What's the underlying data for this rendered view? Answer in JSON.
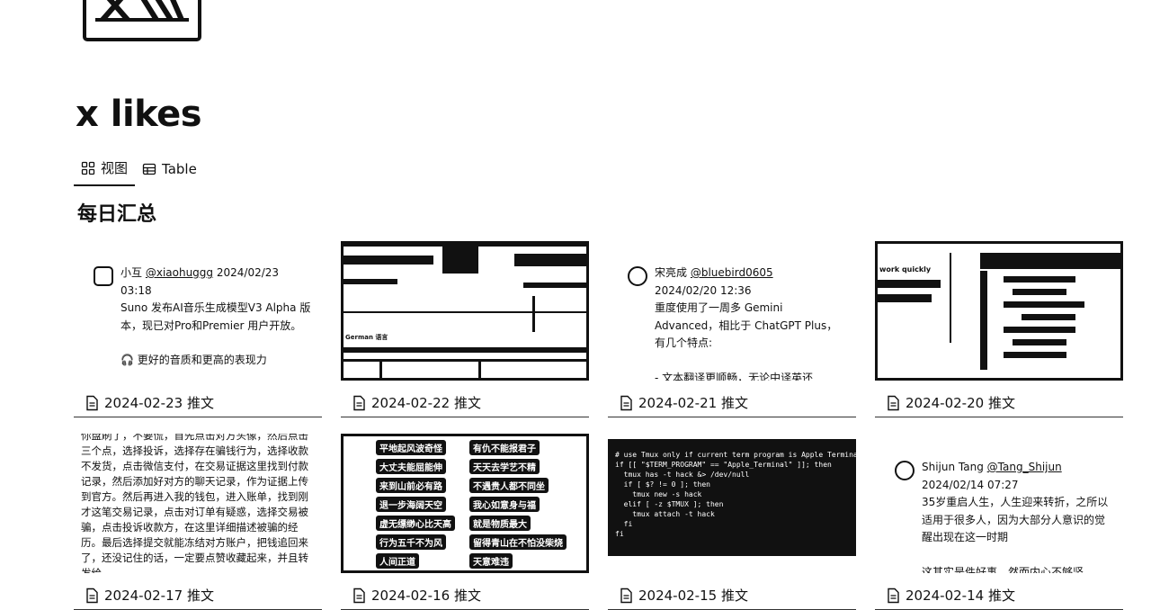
{
  "page": {
    "title": "x likes"
  },
  "tabs": [
    {
      "label": "视图",
      "icon": "gallery-icon",
      "active": true
    },
    {
      "label": "Table",
      "icon": "table-icon",
      "active": false
    }
  ],
  "section": {
    "title": "每日汇总"
  },
  "cards": [
    {
      "footer": "2024-02-23 推文",
      "tweet": {
        "author": "小互",
        "handle": "@xiaohuggg",
        "date": "2024/02/23 03:18",
        "text": "Suno 发布AI音乐生成模型V3 Alpha 版本，现已对Pro和Premier 用户开放。",
        "extra": "🎧 更好的音质和更高的表现力"
      }
    },
    {
      "footer": "2024-02-22 推文",
      "image": "video-screenshot",
      "caption": "German 语言"
    },
    {
      "footer": "2024-02-21 推文",
      "tweet": {
        "author": "宋亮成",
        "handle": "@bluebird0605",
        "date": "2024/02/20 12:36",
        "text": "重度使用了一周多 Gemini Advanced，相比于 ChatGPT Plus，有几个特点:",
        "extra": "- 文本翻译更顺畅，无论中译英还"
      }
    },
    {
      "footer": "2024-02-20 推文",
      "image": "app-screenshot",
      "caption": "work quickly"
    },
    {
      "footer": "2024-02-17 推文",
      "text_block": "你盘刷了，不要慌，首先点击对方头像，然后点击三个点，选择投诉，选择存在骗钱行为，选择收款不发货，点击微信支付，在交易证据这里找到付款记录，然后添加好对方的聊天记录，作为证据上传到官方。然后再进入我的钱包，进入账单，找到刚才这笔交易记录，点击对订单有疑惑，选择交易被骗，点击投诉收款方，在这里详细描述被骗的经历。最后选择提交就能冻结对方账户，把钱追回来了，还没记住的话，一定要点赞收藏起来，并且转发给"
    },
    {
      "footer": "2024-02-16 推文",
      "signs": [
        "平地起风波奇怪",
        "有仇不能报君子",
        "大丈夫能屈能伸",
        "天天去学艺不精",
        "来到山前必有路",
        "不遇贵人都不同坐",
        "退一步海阔天空",
        "我心如意身与福",
        "虚无缥缈心比天高",
        "就是物质最大",
        "行为五千不为风",
        "留得青山在不怕没柴烧",
        "人间正道",
        "天意难违"
      ]
    },
    {
      "footer": "2024-02-15 推文",
      "terminal": [
        "# use Tmux only if current term program is Apple Terminal",
        "if [[ \"$TERM_PROGRAM\" == \"Apple_Terminal\" ]]; then",
        "  tmux has -t hack &> /dev/null",
        "  if [ $? != 0 ]; then",
        "    tmux new -s hack",
        "  elif [ -z $TMUX ]; then",
        "    tmux attach -t hack",
        "  fi",
        "fi"
      ]
    },
    {
      "footer": "2024-02-14 推文",
      "tweet": {
        "author": "Shijun Tang",
        "handle": "@Tang_Shijun",
        "date": "2024/02/14 07:27",
        "text": "35岁重启人生，人生迎来转折，之所以适用于很多人，因为大部分人意识的觉醒出现在这一时期",
        "extra": "这其实是件好事，然而内心不够坚"
      }
    }
  ]
}
